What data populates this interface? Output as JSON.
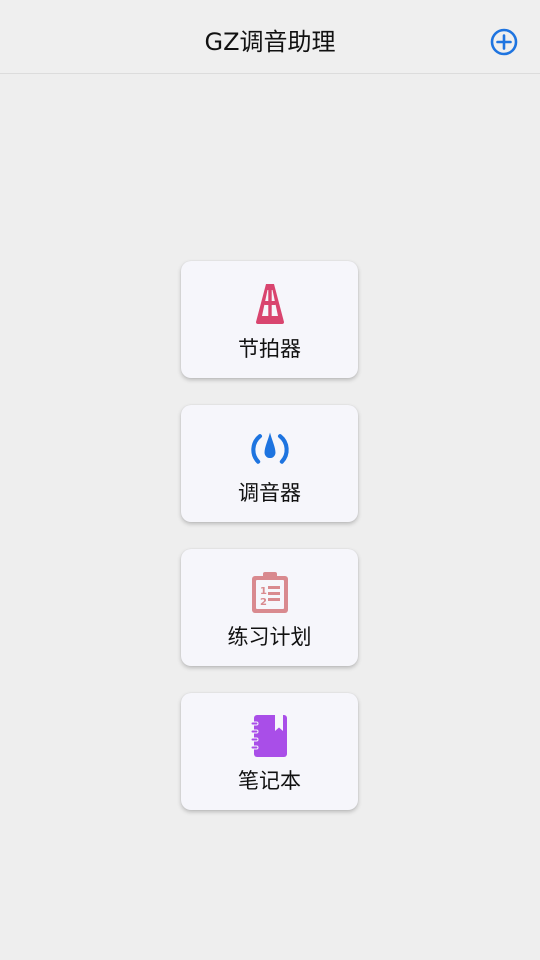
{
  "app": {
    "title": "GZ调音助理"
  },
  "colors": {
    "accent": "#1e74e0",
    "metronome": "#d9456f",
    "tuner": "#1e74e0",
    "plan": "#d98a8f",
    "notebook": "#a94ee8"
  },
  "menu": {
    "items": [
      {
        "label": "节拍器",
        "icon": "metronome-icon"
      },
      {
        "label": "调音器",
        "icon": "tuner-icon"
      },
      {
        "label": "练习计划",
        "icon": "checklist-icon"
      },
      {
        "label": "笔记本",
        "icon": "notebook-icon"
      }
    ]
  }
}
